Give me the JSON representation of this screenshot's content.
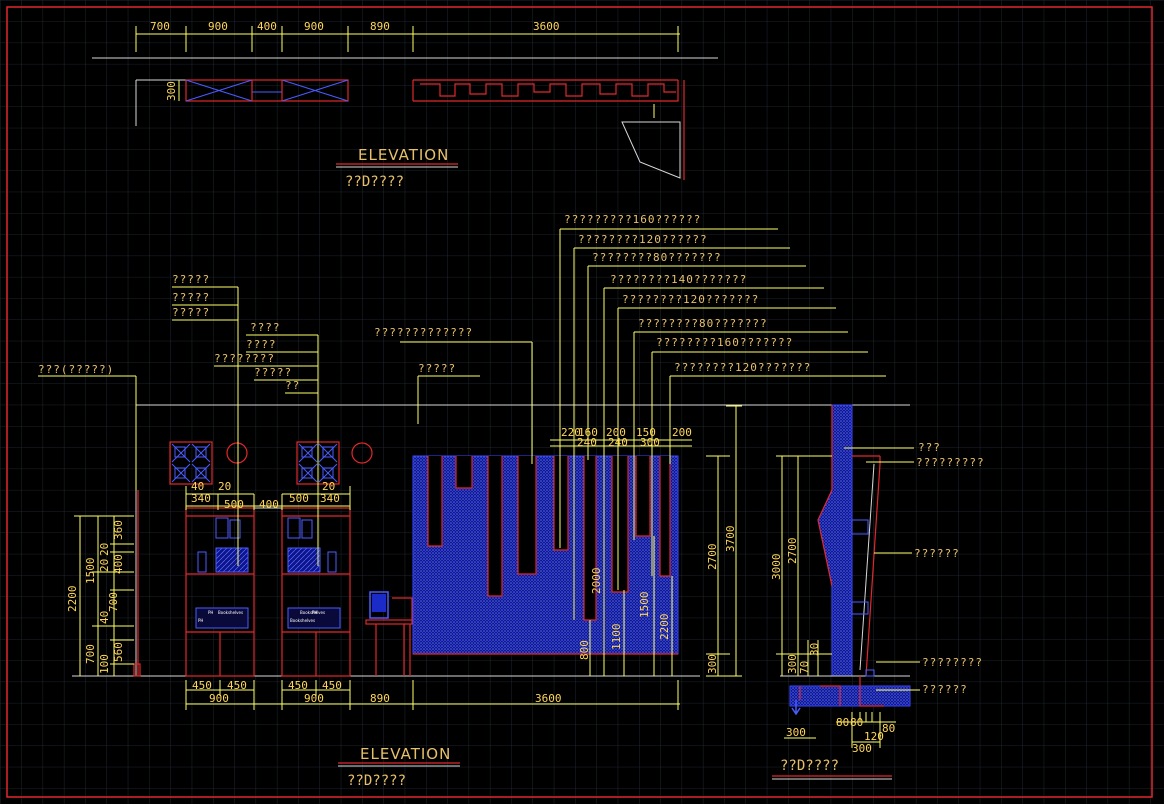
{
  "colors": {
    "background": "#000000",
    "grid": "#23303a",
    "frame": "#e0282c",
    "dimension": "#ffff66",
    "annotation": "#e8c06a",
    "hatch": "#3a46ff"
  },
  "top_view": {
    "dimensions": [
      "700",
      "900",
      "400",
      "900",
      "890",
      "3600"
    ],
    "depth": "300",
    "title": "ELEVATION",
    "subtitle": "??D????"
  },
  "front_elevation": {
    "callouts_left": [
      "???(?????)",
      "?????",
      "?????",
      "?????",
      "????",
      "????",
      "????????",
      "?????",
      "??"
    ],
    "callouts_center": [
      "?????????????",
      "?????"
    ],
    "callouts_panels": [
      "?????????160??????",
      "????????120??????",
      "????????80???????",
      "????????140???????",
      "????????120???????",
      "????????80???????",
      "????????160???????",
      "????????120???????"
    ],
    "cabinet_top_dims": [
      "40",
      "20",
      "340",
      "500",
      "400",
      "500",
      "20",
      "340"
    ],
    "panel_top_dims": [
      "220",
      "160",
      "240",
      "200",
      "240",
      "150",
      "300",
      "200"
    ],
    "left_vertical_dims": [
      "2200",
      "1500",
      "700",
      "700",
      "360",
      "20",
      "20",
      "400",
      "40",
      "560",
      "100"
    ],
    "panel_vertical_dims": [
      "2000",
      "1100",
      "1500",
      "2200",
      "800"
    ],
    "right_vertical_dims": [
      "2700",
      "3700",
      "300"
    ],
    "bottom_dims": [
      "450",
      "450",
      "450",
      "450",
      "900",
      "900",
      "890",
      "3600"
    ],
    "book_labels": [
      "PH",
      "Bookshelves",
      "PH",
      "Bookshelves",
      "PH",
      "Bookshelves"
    ],
    "title": "ELEVATION",
    "subtitle": "??D????"
  },
  "section": {
    "callouts": [
      "???",
      "?????????",
      "??????",
      "????????",
      "??????"
    ],
    "vertical_dims": [
      "3000",
      "2700",
      "300",
      "70",
      "30"
    ],
    "bottom_dims": [
      "80",
      "80",
      "120",
      "80",
      "300",
      "300"
    ],
    "subtitle": "??D????"
  }
}
